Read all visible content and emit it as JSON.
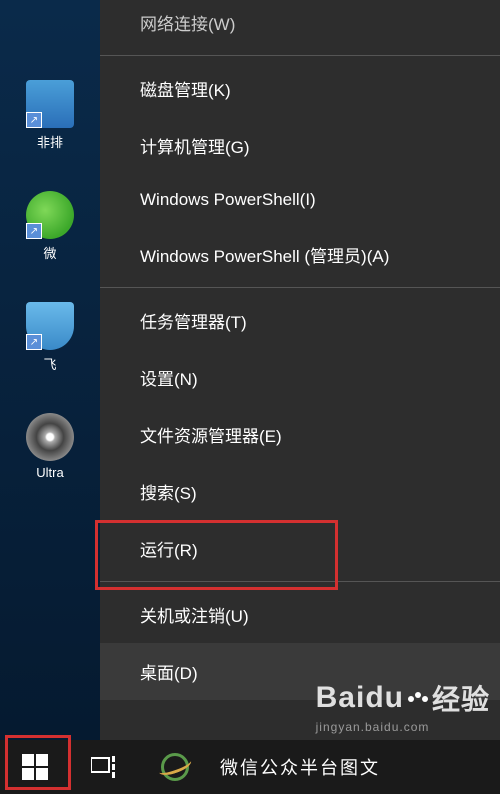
{
  "desktop": {
    "icons": [
      {
        "label": "非排",
        "type": "blue"
      },
      {
        "label": "微",
        "type": "green"
      },
      {
        "label": "飞",
        "type": "plane"
      },
      {
        "label": "Ultra",
        "type": "disc"
      }
    ]
  },
  "menu": {
    "partial_top": "网络连接(W)",
    "items": [
      {
        "label": "磁盘管理(K)",
        "id": "disk-management"
      },
      {
        "label": "计算机管理(G)",
        "id": "computer-management"
      },
      {
        "label": "Windows PowerShell(I)",
        "id": "powershell"
      },
      {
        "label": "Windows PowerShell (管理员)(A)",
        "id": "powershell-admin"
      }
    ],
    "items2": [
      {
        "label": "任务管理器(T)",
        "id": "task-manager"
      },
      {
        "label": "设置(N)",
        "id": "settings"
      },
      {
        "label": "文件资源管理器(E)",
        "id": "file-explorer"
      },
      {
        "label": "搜索(S)",
        "id": "search"
      },
      {
        "label": "运行(R)",
        "id": "run"
      }
    ],
    "items3": [
      {
        "label": "关机或注销(U)",
        "id": "shutdown"
      },
      {
        "label": "桌面(D)",
        "id": "desktop",
        "hovered": true
      }
    ]
  },
  "taskbar": {
    "app_text": "微信公众半台图文"
  },
  "watermark": {
    "brand": "Baidu",
    "cn": "经验",
    "url": "jingyan.baidu.com"
  }
}
